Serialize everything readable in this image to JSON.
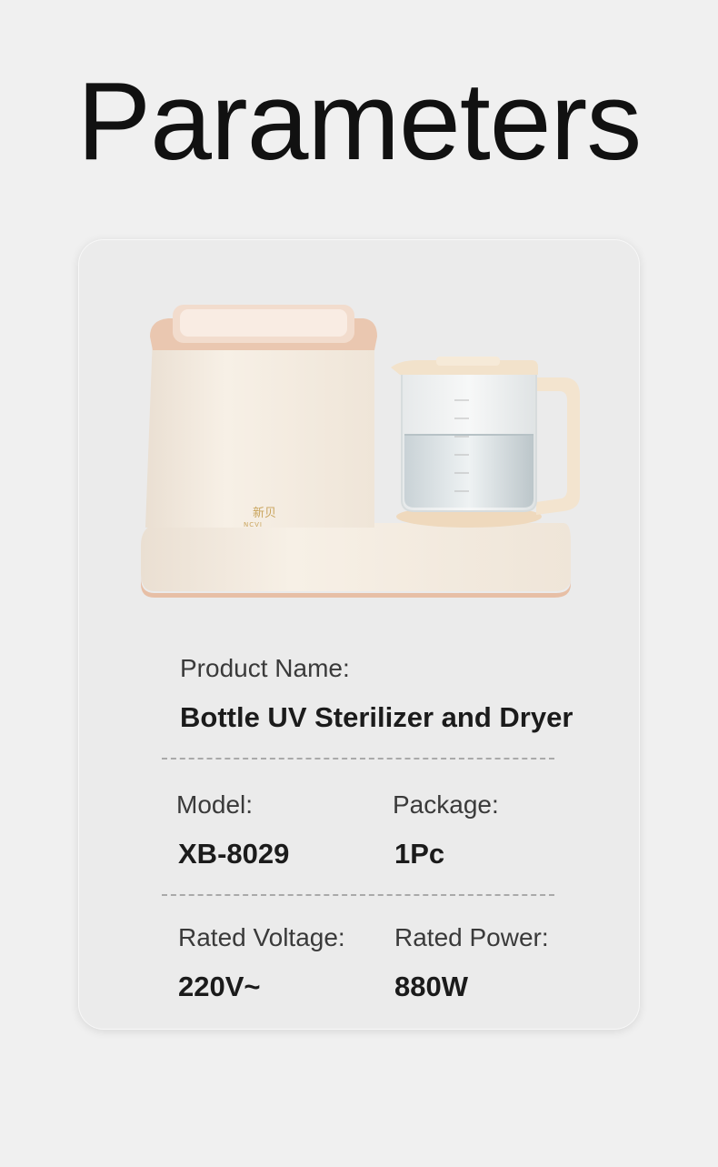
{
  "title": "Parameters",
  "product_image": {
    "brand_cn": "新贝",
    "brand_en": "NCVI"
  },
  "specs": {
    "product_name": {
      "label": "Product Name:",
      "value": "Bottle UV Sterilizer and Dryer"
    },
    "model": {
      "label": "Model:",
      "value": "XB-8029"
    },
    "package": {
      "label": "Package:",
      "value": "1Pc"
    },
    "rated_voltage": {
      "label": "Rated Voltage:",
      "value": "220V~"
    },
    "rated_power": {
      "label": "Rated Power:",
      "value": "880W"
    }
  },
  "colors": {
    "background": "#f0f0f0",
    "card": "#ebebeb",
    "appliance_body": "#f5ece1",
    "appliance_trim": "#e8c3aa"
  }
}
